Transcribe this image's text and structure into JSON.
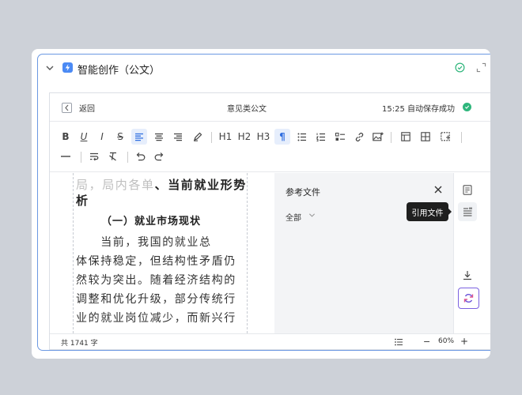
{
  "panel": {
    "title": "智能创作（公文）"
  },
  "editor": {
    "back_label": "返回",
    "doc_title": "意见类公文",
    "save_status": "15:25 自动保存成功"
  },
  "toolbar": {
    "bold": "B",
    "italic": "I",
    "underline": "U",
    "strike": "S",
    "h1": "H1",
    "h2": "H2",
    "h3": "H3",
    "paragraph": "¶"
  },
  "document": {
    "lines": [
      {
        "ghost": "局，局内各单",
        "text": "、当前就业形势分"
      },
      {
        "text": "析"
      },
      {
        "text": "（一）就业市场现状"
      },
      {
        "text": "　　当前，我国的就业总"
      },
      {
        "text": "体保持稳定，但结构性矛盾仍"
      },
      {
        "text": "然较为突出。随着经济结构的"
      },
      {
        "text": "调整和优化升级，部分传统行"
      },
      {
        "text": "业的就业岗位减少，而新兴行"
      }
    ]
  },
  "ref_panel": {
    "title": "参考文件",
    "filter": "全部"
  },
  "tooltip": "引用文件",
  "status": {
    "word_count": "共 1741 字",
    "zoom_out": "−",
    "zoom": "60%",
    "zoom_in": "+"
  }
}
